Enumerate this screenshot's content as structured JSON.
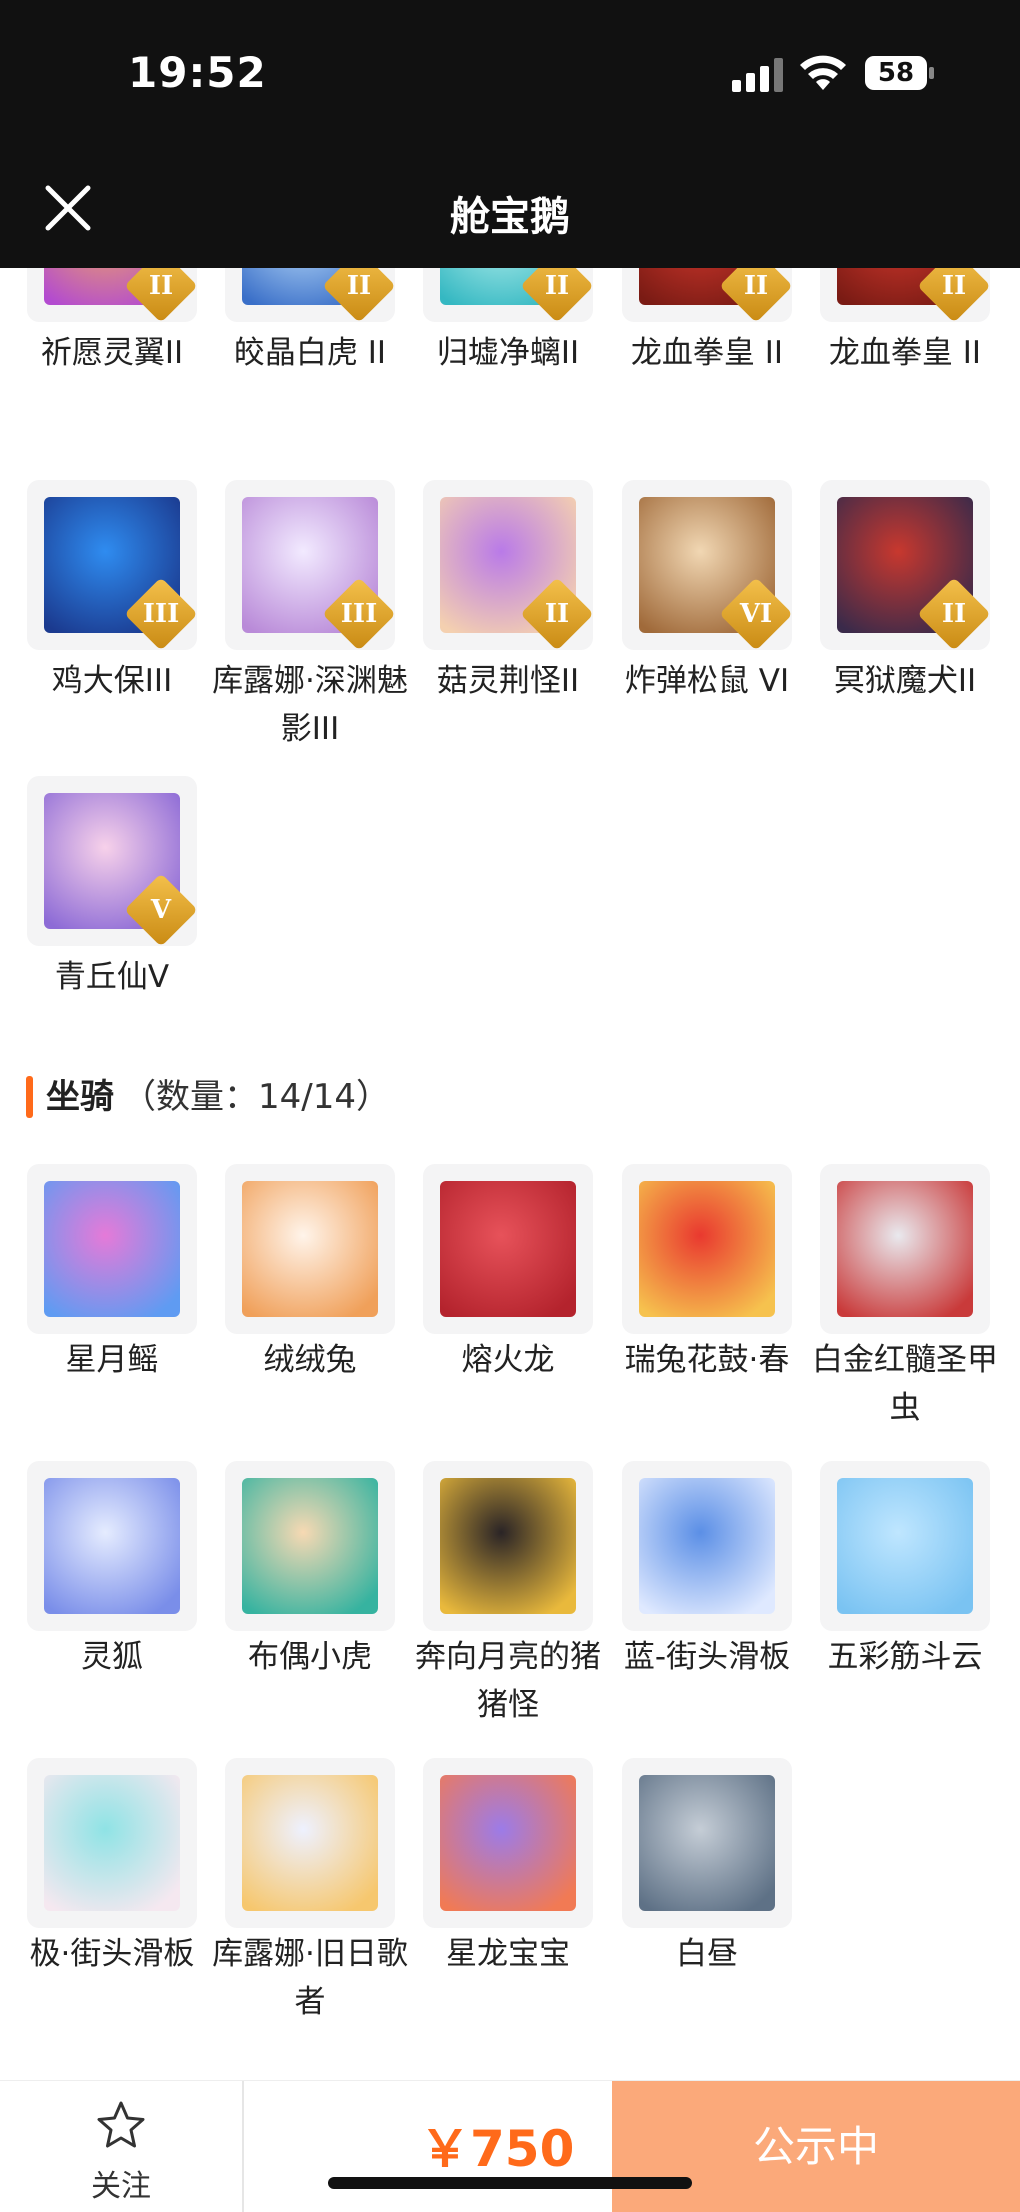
{
  "status_bar": {
    "time": "19:52",
    "battery": "58"
  },
  "nav": {
    "title": "舱宝鹅"
  },
  "top_items": [
    {
      "label": "祈愿灵翼II",
      "badge": "II",
      "colors": [
        "#f3ad5a",
        "#b34bd0"
      ]
    },
    {
      "label": "皎晶白虎 II",
      "badge": "II",
      "colors": [
        "#c7e7ff",
        "#3a6fc8"
      ]
    },
    {
      "label": "归墟净螭II",
      "badge": "II",
      "colors": [
        "#bff4f1",
        "#35b8c2"
      ]
    },
    {
      "label": "龙血拳皇 II",
      "badge": "II",
      "colors": [
        "#d83a2f",
        "#7a1b14"
      ]
    },
    {
      "label": "龙血拳皇 II",
      "badge": "II",
      "colors": [
        "#d83a2f",
        "#7a1b14"
      ]
    },
    {
      "label": "鸡大保III",
      "badge": "III",
      "colors": [
        "#2f8cf0",
        "#1b3a8f"
      ]
    },
    {
      "label": "库露娜·深渊魅影III",
      "badge": "III",
      "colors": [
        "#f2eaff",
        "#b98ad8"
      ]
    },
    {
      "label": "菇灵荆怪II",
      "badge": "II",
      "colors": [
        "#b97ae8",
        "#f4d0b0"
      ]
    },
    {
      "label": "炸弹松鼠 VI",
      "badge": "VI",
      "colors": [
        "#f1d7b3",
        "#a06a3a"
      ]
    },
    {
      "label": "冥狱魔犬II",
      "badge": "II",
      "colors": [
        "#c8382e",
        "#3a2a4a"
      ]
    },
    {
      "label": "青丘仙V",
      "badge": "V",
      "colors": [
        "#f7d1ea",
        "#8d6bd6"
      ]
    }
  ],
  "mounts_section": {
    "title": "坐骑",
    "count_text": "（数量：14/14）"
  },
  "mounts": [
    {
      "label": "星月鳐",
      "colors": [
        "#e57ad8",
        "#5f9bf2"
      ]
    },
    {
      "label": "绒绒兔",
      "colors": [
        "#fff4ea",
        "#f0a05a"
      ]
    },
    {
      "label": "熔火龙",
      "colors": [
        "#e7525a",
        "#b4232d"
      ]
    },
    {
      "label": "瑞兔花鼓·春",
      "colors": [
        "#e9392f",
        "#f6c24e"
      ]
    },
    {
      "label": "白金红髓圣甲虫",
      "colors": [
        "#e9e9ee",
        "#c93a3a"
      ]
    },
    {
      "label": "灵狐",
      "colors": [
        "#e5ecff",
        "#7a8ee9"
      ]
    },
    {
      "label": "布偶小虎",
      "colors": [
        "#f7d9b3",
        "#36b3a0"
      ]
    },
    {
      "label": "奔向月亮的猪猪怪",
      "colors": [
        "#2a2426",
        "#e9b93c"
      ]
    },
    {
      "label": "蓝-街头滑板",
      "colors": [
        "#5b8fe6",
        "#dfe9ff"
      ]
    },
    {
      "label": "五彩筋斗云",
      "colors": [
        "#bfe6ff",
        "#7ac3f2"
      ]
    },
    {
      "label": "极·街头滑板",
      "colors": [
        "#8fe3e5",
        "#f5e8f0"
      ]
    },
    {
      "label": "库露娜·旧日歌者",
      "colors": [
        "#eef1ff",
        "#f6c76e"
      ]
    },
    {
      "label": "星龙宝宝",
      "colors": [
        "#9c7be8",
        "#f17a54"
      ]
    },
    {
      "label": "白昼",
      "colors": [
        "#c5cdd6",
        "#5e7186"
      ]
    }
  ],
  "bottom_bar": {
    "follow_label": "关注",
    "price": "￥750",
    "status_label": "公示中"
  }
}
